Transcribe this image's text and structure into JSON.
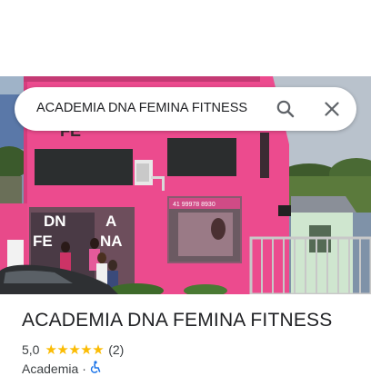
{
  "search": {
    "query": "ACADEMIA DNA FEMINA FITNESS",
    "search_icon": "search-icon",
    "clear_icon": "close-icon"
  },
  "photo": {
    "sign_letters_left": [
      "DN",
      "FE"
    ],
    "sign_letters_right": [
      "A",
      "NA"
    ],
    "wall_top_letters": "FE",
    "phone_sign": "41 99978 8930"
  },
  "place": {
    "name": "ACADEMIA DNA FEMINA FITNESS",
    "rating": "5,0",
    "stars": "★★★★★",
    "review_count": "(2)",
    "category": "Academia",
    "separator": "·",
    "accessibility_icon": "wheelchair-icon"
  },
  "colors": {
    "building_pink": "#ec4b8e",
    "star_yellow": "#fbbc04",
    "text_primary": "#202124",
    "text_secondary": "#3c4043",
    "accessibility_blue": "#1a73e8"
  }
}
